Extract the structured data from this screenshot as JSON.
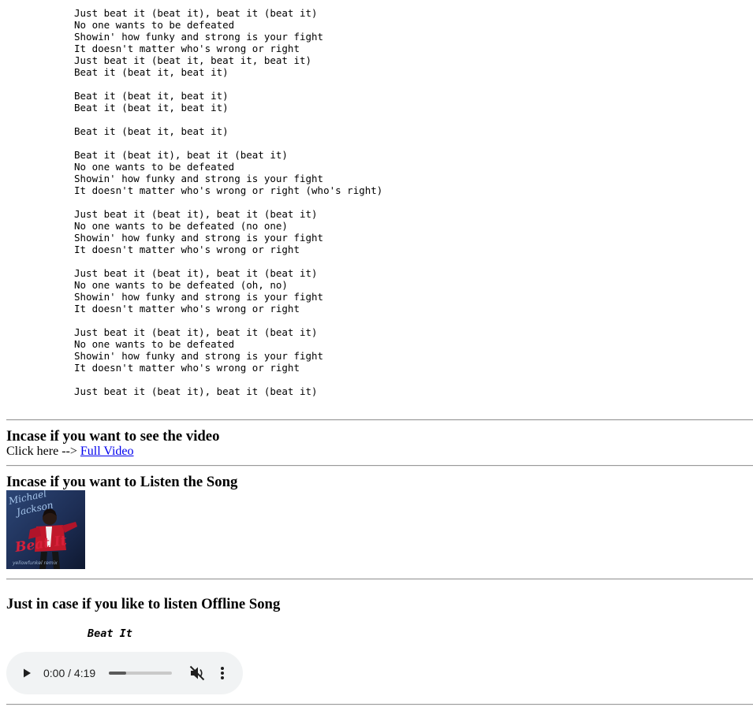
{
  "lyrics": "Just beat it (beat it), beat it (beat it)\nNo one wants to be defeated\nShowin' how funky and strong is your fight\nIt doesn't matter who's wrong or right\nJust beat it (beat it, beat it, beat it)\nBeat it (beat it, beat it)\n\nBeat it (beat it, beat it)\nBeat it (beat it, beat it)\n\nBeat it (beat it, beat it)\n\nBeat it (beat it), beat it (beat it)\nNo one wants to be defeated\nShowin' how funky and strong is your fight\nIt doesn't matter who's wrong or right (who's right)\n\nJust beat it (beat it), beat it (beat it)\nNo one wants to be defeated (no one)\nShowin' how funky and strong is your fight\nIt doesn't matter who's wrong or right\n\nJust beat it (beat it), beat it (beat it)\nNo one wants to be defeated (oh, no)\nShowin' how funky and strong is your fight\nIt doesn't matter who's wrong or right\n\nJust beat it (beat it), beat it (beat it)\nNo one wants to be defeated\nShowin' how funky and strong is your fight\nIt doesn't matter who's wrong or right\n\nJust beat it (beat it), beat it (beat it)",
  "video_section": {
    "heading": "Incase if you want to see the video",
    "prompt": "Click here --> ",
    "link_text": "Full Video"
  },
  "listen_section": {
    "heading": "Incase if you want to Listen the Song",
    "cover_text_top": "Michael Jackson",
    "cover_text_bottom": "Beat It",
    "cover_text_small": "yellowfunkel remix"
  },
  "offline_section": {
    "heading": "Just in case if you like to listen Offline Song",
    "song_title": "Beat It"
  },
  "player": {
    "time_display": "0:00 / 4:19",
    "progress_fraction": 0.27,
    "muted": true
  },
  "colors": {
    "link": "#0000ee",
    "player_bg": "#f1f3f4",
    "cover_bg": "#1c2c52",
    "cover_jacket": "#c0182a"
  }
}
